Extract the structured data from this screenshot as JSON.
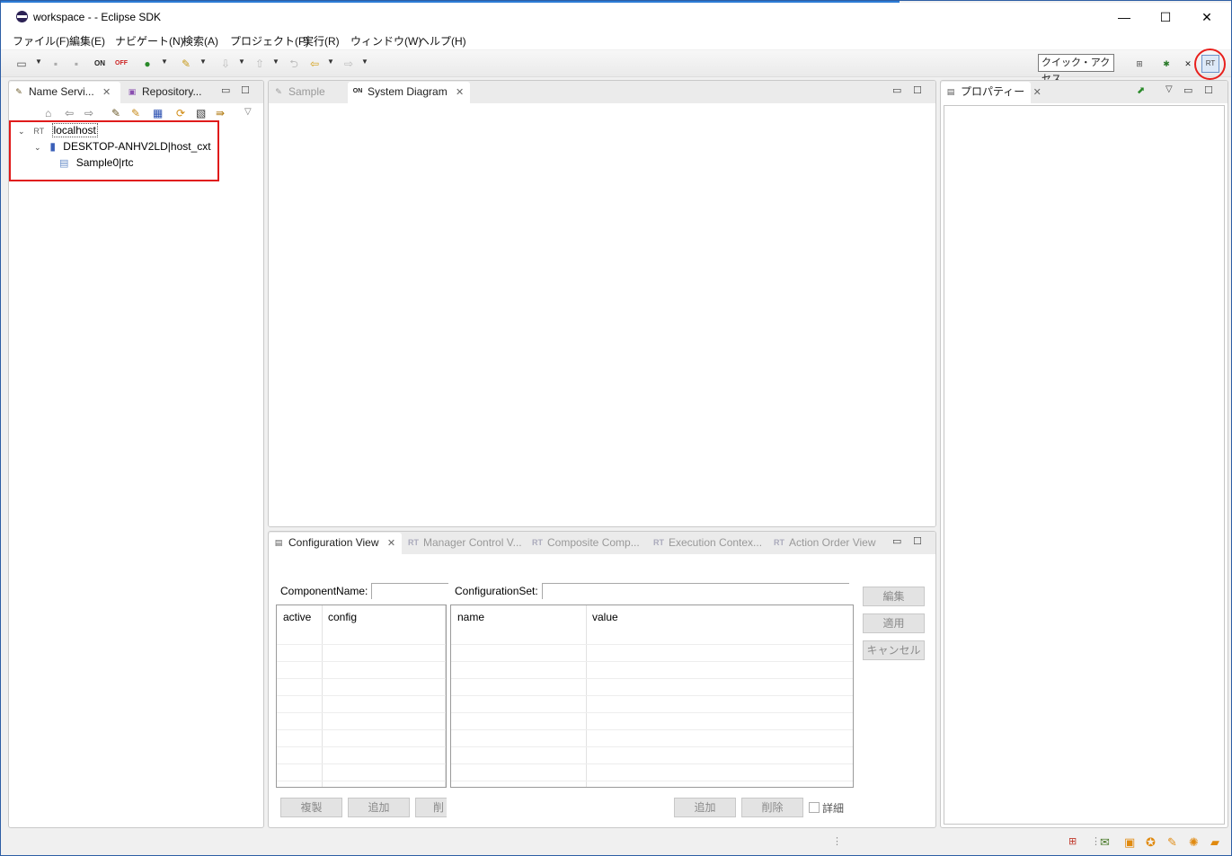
{
  "window": {
    "title": "workspace -  - Eclipse SDK",
    "minimize": "—",
    "maximize": "☐",
    "close": "✕"
  },
  "menu": [
    "ファイル(F)",
    "編集(E)",
    "ナビゲート(N)",
    "検索(A)",
    "プロジェクト(P)",
    "実行(R)",
    "ウィンドウ(W)",
    "ヘルプ(H)"
  ],
  "toolbar": {
    "quick_access": "クイック・アクセス",
    "on_label": "ON",
    "off_label": "OFF",
    "rt_label": "RT"
  },
  "left_panel": {
    "tabs": [
      {
        "label": "Name Servi...",
        "close": "✕"
      },
      {
        "label": "Repository...",
        "close": ""
      }
    ],
    "tree": {
      "host": "localhost",
      "host_icon": "RT",
      "context": "DESKTOP-ANHV2LD|host_cxt",
      "component": "Sample0|rtc"
    }
  },
  "editor": {
    "tabs": [
      {
        "label": "Sample",
        "close": ""
      },
      {
        "label": "System Diagram",
        "close": "✕"
      }
    ]
  },
  "properties": {
    "tab": {
      "label": "プロパティー",
      "close": "✕"
    }
  },
  "bottom_panel": {
    "tabs": [
      {
        "label": "Configuration View",
        "close": "✕"
      },
      {
        "label": "Manager Control V...",
        "close": ""
      },
      {
        "label": "Composite Comp...",
        "close": ""
      },
      {
        "label": "Execution Contex...",
        "close": ""
      },
      {
        "label": "Action Order View",
        "close": ""
      }
    ],
    "component_name_label": "ComponentName:",
    "configuration_set_label": "ConfigurationSet:",
    "left_table": {
      "columns": [
        "active",
        "config"
      ]
    },
    "right_table": {
      "columns": [
        "name",
        "value"
      ]
    },
    "side_buttons": [
      "編集",
      "適用",
      "キャンセル"
    ],
    "left_buttons": [
      "複製",
      "追加",
      "削"
    ],
    "right_buttons": [
      "追加",
      "削除"
    ],
    "detail_label": "詳細"
  },
  "icons": {
    "minimize": "▭",
    "maximize": "☐",
    "view_menu": "▽"
  }
}
